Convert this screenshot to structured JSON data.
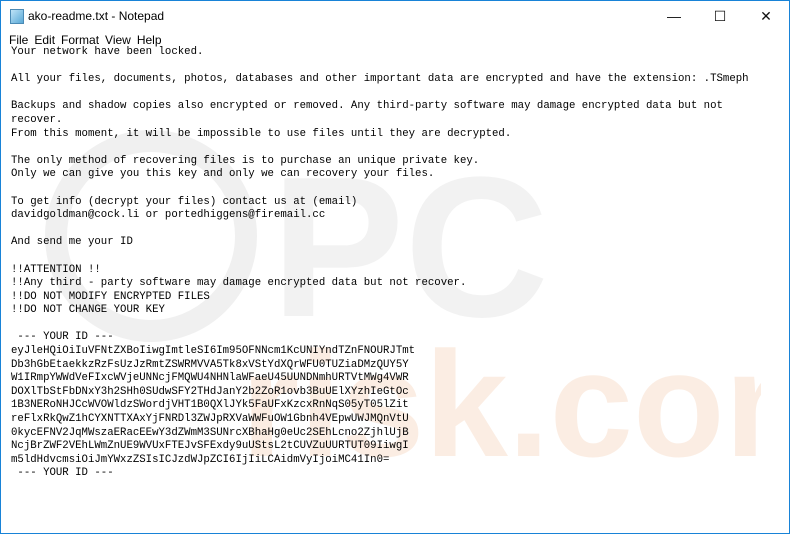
{
  "window": {
    "title": "ako-readme.txt - Notepad",
    "icon": "notepad-icon"
  },
  "controls": {
    "minimize": "—",
    "maximize": "☐",
    "close": "✕"
  },
  "menu": [
    "File",
    "Edit",
    "Format",
    "View",
    "Help"
  ],
  "document": {
    "lines": [
      "Your network have been locked.",
      "",
      "All your files, documents, photos, databases and other important data are encrypted and have the extension: .TSmeph",
      "",
      "Backups and shadow copies also encrypted or removed. Any third-party software may damage encrypted data but not",
      "recover.",
      "From this moment, it will be impossible to use files until they are decrypted.",
      "",
      "The only method of recovering files is to purchase an unique private key.",
      "Only we can give you this key and only we can recovery your files.",
      "",
      "To get info (decrypt your files) contact us at (email)",
      "davidgoldman@cock.li or portedhiggens@firemail.cc",
      "",
      "And send me your ID",
      "",
      "!!ATTENTION !!",
      "!!Any third - party software may damage encrypted data but not recover.",
      "!!DO NOT MODIFY ENCRYPTED FILES",
      "!!DO NOT CHANGE YOUR KEY",
      "",
      " --- YOUR ID ---",
      "eyJleHQiOiIuVFNtZXBoIiwgImtleSI6Im95OFNNcm1KcUNIYndTZnFNOURJTmt",
      "Db3hGbEtaekkzRzFsUzJzRmtZSWRMVVA5Tk8xVStYdXQrWFU0TUZiaDMzQUY5Y",
      "W1IRmpYWWdVeFIxcWVjeUNNcjFMQWU4NHNlaWFaeU45UUNDNmhURTVtMWg4VWR",
      "DOXlTbStFbDNxY3h2SHh0SUdwSFY2THdJanY2b2ZoR1ovb3BuUElXYzhIeGtOc",
      "1B3NERoNHJCcWVOWldzSWordjVHT1B0QXlJYk5FaUFxKzcxRnNqS05yT05lZit",
      "reFlxRkQwZ1hCYXNTTXAxYjFNRDl3ZWJpRXVaWWFuOW1Gbnh4VEpwUWJMQnVtU",
      "0kycEFNV2JqMWszaERacEEwY3dZWmM3SUNrcXBhaHg0eUc2SEhLcno2ZjhlUjB",
      "NcjBrZWF2VEhLWmZnUE9WVUxFTEJvSFExdy9uUStsL2tCUVZuUURTUT09IiwgI",
      "m5ldHdvcmsiOiJmYWxzZSIsICJzdWJpZCI6IjIiLCAidmVyIjoiMC41In0=",
      " --- YOUR ID ---"
    ]
  }
}
